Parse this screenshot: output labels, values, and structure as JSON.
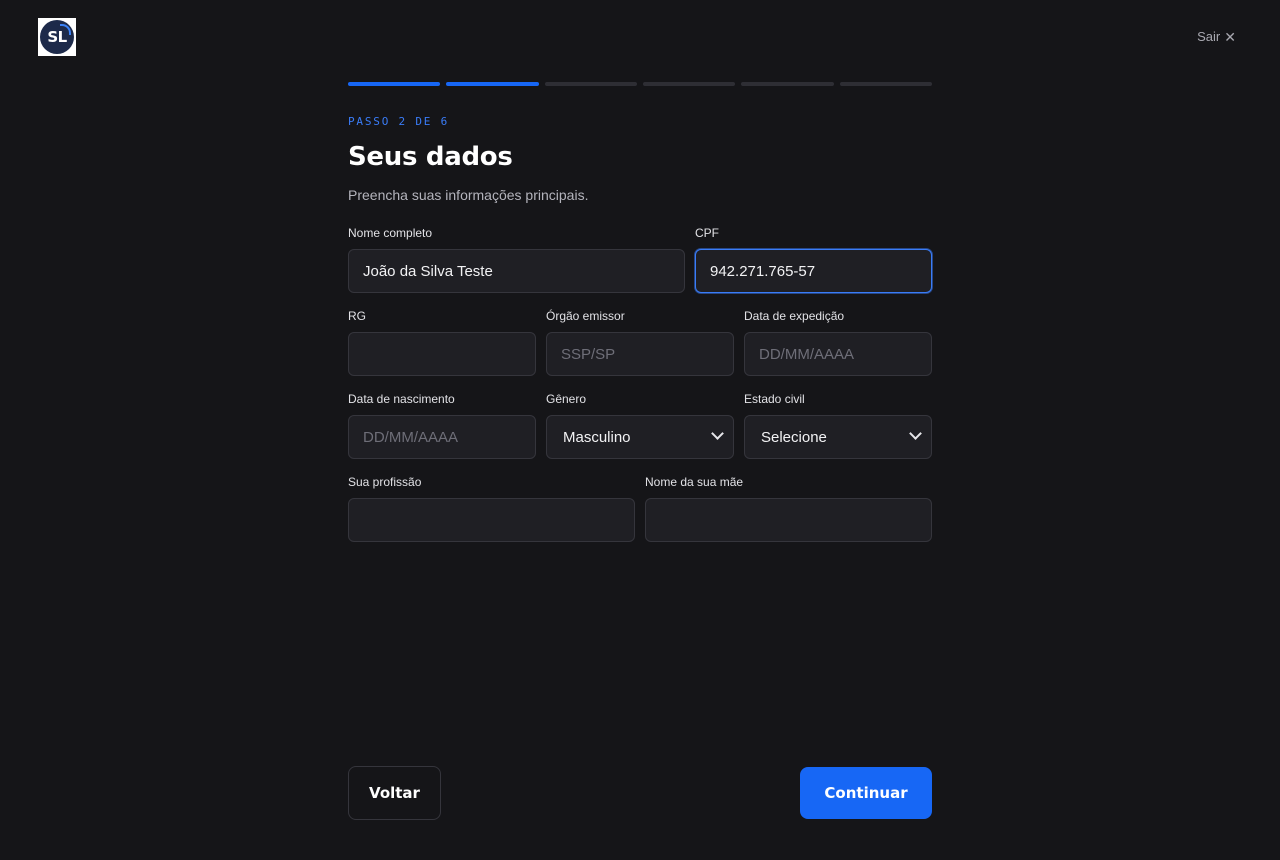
{
  "header": {
    "logo_text": "SL",
    "exit_label": "Sair",
    "exit_icon": "close-icon"
  },
  "progress": {
    "total_steps": 6,
    "completed_steps": 2,
    "active_color": "#1767f5",
    "inactive_color": "#2e2e34"
  },
  "step": {
    "label": "PASSO 2 DE 6",
    "title": "Seus dados",
    "subtitle": "Preencha suas informações principais."
  },
  "form": {
    "full_name": {
      "label": "Nome completo",
      "value": "João da Silva Teste",
      "placeholder": ""
    },
    "cpf": {
      "label": "CPF",
      "value": "942.271.765-57",
      "placeholder": ""
    },
    "rg": {
      "label": "RG",
      "value": "",
      "placeholder": ""
    },
    "issuer": {
      "label": "Órgão emissor",
      "value": "",
      "placeholder": "SSP/SP"
    },
    "issue_date": {
      "label": "Data de expedição",
      "value": "",
      "placeholder": "DD/MM/AAAA"
    },
    "birth_date": {
      "label": "Data de nascimento",
      "value": "",
      "placeholder": "DD/MM/AAAA"
    },
    "gender": {
      "label": "Gênero",
      "selected": "Masculino"
    },
    "marital_status": {
      "label": "Estado civil",
      "selected": "Selecione"
    },
    "profession": {
      "label": "Sua profissão",
      "value": "",
      "placeholder": ""
    },
    "mother_name": {
      "label": "Nome da sua mãe",
      "value": "",
      "placeholder": ""
    }
  },
  "actions": {
    "back_label": "Voltar",
    "continue_label": "Continuar",
    "primary_color": "#1767f5"
  }
}
